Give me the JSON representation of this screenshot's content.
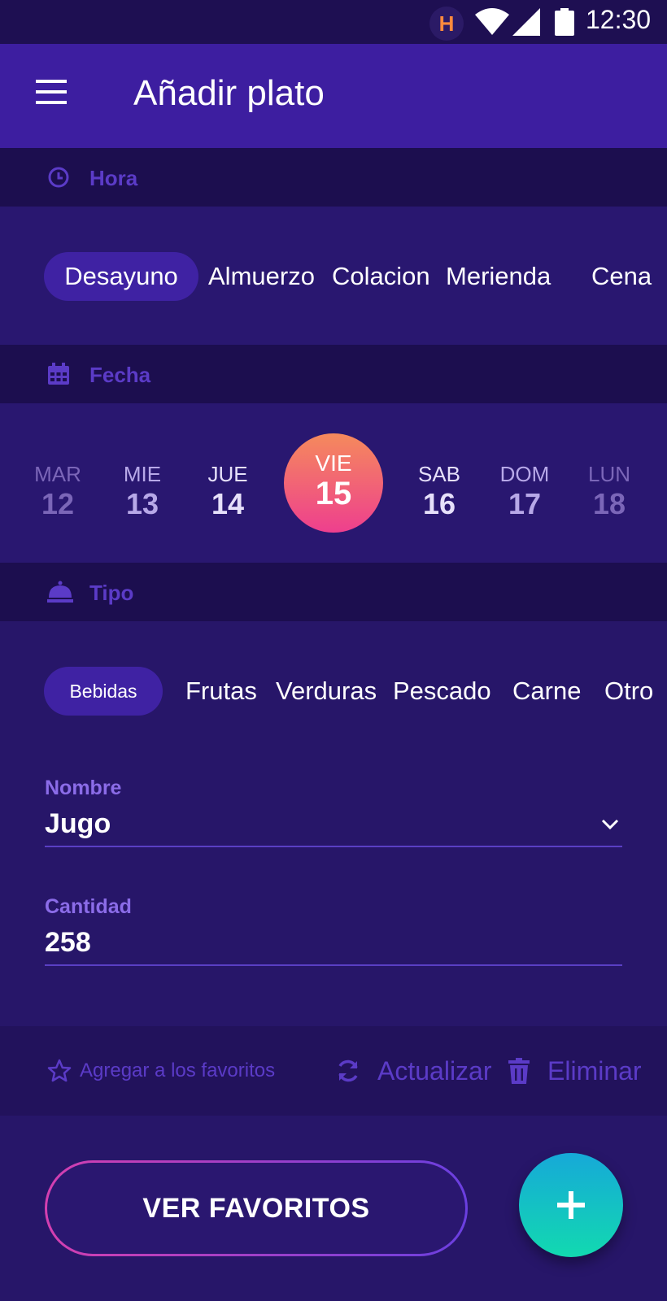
{
  "status_bar": {
    "time": "12:30",
    "app_badge": "H"
  },
  "app_bar": {
    "title": "Añadir plato",
    "menu_icon": "menu-icon"
  },
  "sections": {
    "hora": "Hora",
    "fecha": "Fecha",
    "tipo": "Tipo"
  },
  "meals": {
    "items": [
      "Desayuno",
      "Almuerzo",
      "Colacion",
      "Merienda",
      "Cena"
    ],
    "selected": "Desayuno"
  },
  "days": [
    {
      "name": "MAR",
      "num": "12"
    },
    {
      "name": "MIE",
      "num": "13"
    },
    {
      "name": "JUE",
      "num": "14"
    },
    {
      "name": "VIE",
      "num": "15"
    },
    {
      "name": "SAB",
      "num": "16"
    },
    {
      "name": "DOM",
      "num": "17"
    },
    {
      "name": "LUN",
      "num": "18"
    }
  ],
  "types": {
    "items": [
      "Bebidas",
      "Frutas",
      "Verduras",
      "Pescado",
      "Carne",
      "Otro"
    ],
    "selected": "Bebidas"
  },
  "form": {
    "nombre_label": "Nombre",
    "nombre_value": "Jugo",
    "cantidad_label": "Cantidad",
    "cantidad_value": "258"
  },
  "actions": {
    "favorite": "Agregar a los favoritos",
    "update": "Actualizar",
    "delete": "Eliminar"
  },
  "buttons": {
    "ver_favoritos": "VER FAVORITOS",
    "add": "+"
  },
  "colors": {
    "background": "#271669",
    "app_bar": "#3d1ea0",
    "section_header": "#1c0e4f",
    "accent_chip": "#3f22a3",
    "label_purple": "#5b3bc7",
    "date_gradient_start": "#f58a5c",
    "date_gradient_end": "#ee3f8e",
    "fab_gradient_start": "#16a9d8",
    "fab_gradient_end": "#12d9b0"
  }
}
